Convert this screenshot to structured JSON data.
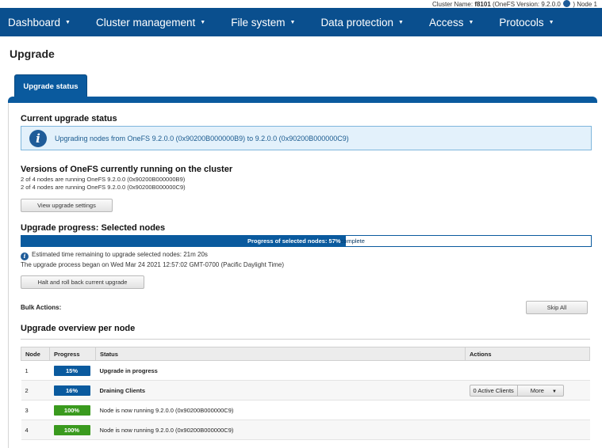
{
  "topbar": {
    "cluster_label": "Cluster Name:",
    "cluster_name": "f8101",
    "version_text": "(OneFS Version: 9.2.0.0",
    "node_text": ") Node 1"
  },
  "nav": [
    {
      "label": "Dashboard",
      "name": "nav-dashboard"
    },
    {
      "label": "Cluster management",
      "name": "nav-cluster-management"
    },
    {
      "label": "File system",
      "name": "nav-file-system"
    },
    {
      "label": "Data protection",
      "name": "nav-data-protection"
    },
    {
      "label": "Access",
      "name": "nav-access"
    },
    {
      "label": "Protocols",
      "name": "nav-protocols"
    }
  ],
  "page": {
    "title": "Upgrade",
    "tab_label": "Upgrade status"
  },
  "current": {
    "heading": "Current upgrade status",
    "message": "Upgrading nodes from OneFS 9.2.0.0 (0x90200B000000B9) to 9.2.0.0 (0x90200B000000C9)"
  },
  "versions": {
    "heading": "Versions of OneFS currently running on the cluster",
    "line1": "2 of 4 nodes are running OneFS 9.2.0.0 (0x90200B000000B9)",
    "line2": "2 of 4 nodes are running OneFS 9.2.0.0 (0x90200B000000C9)",
    "view_button": "View upgrade settings"
  },
  "progress": {
    "heading": "Upgrade progress: Selected nodes",
    "bar_label": "Progress of selected nodes: 57%",
    "bar_suffix": " complete",
    "percent": 57,
    "estimate": "Estimated time remaining to upgrade selected nodes: 21m 20s",
    "began": "The upgrade process began on Wed Mar 24 2021 12:57:02 GMT-0700 (Pacific Daylight Time)",
    "halt_button": "Halt and roll back current upgrade"
  },
  "bulk": {
    "label": "Bulk Actions:",
    "skip_all": "Skip All"
  },
  "overview": {
    "heading": "Upgrade overview per node",
    "columns": [
      "Node",
      "Progress",
      "Status",
      "Actions"
    ],
    "rows": [
      {
        "node": "1",
        "progress": "15%",
        "color": "#0a5a9e",
        "status": "Upgrade in progress",
        "bold": true
      },
      {
        "node": "2",
        "progress": "16%",
        "color": "#0a5a9e",
        "status": "Draining Clients",
        "bold": true,
        "action_clients": "0 Active Clients",
        "action_more": "More"
      },
      {
        "node": "3",
        "progress": "100%",
        "color": "#3a9a1e",
        "status": "Node is now running 9.2.0.0 (0x90200B000000C9)",
        "bold": false
      },
      {
        "node": "4",
        "progress": "100%",
        "color": "#3a9a1e",
        "status": "Node is now running 9.2.0.0 (0x90200B000000C9)",
        "bold": false
      }
    ]
  }
}
